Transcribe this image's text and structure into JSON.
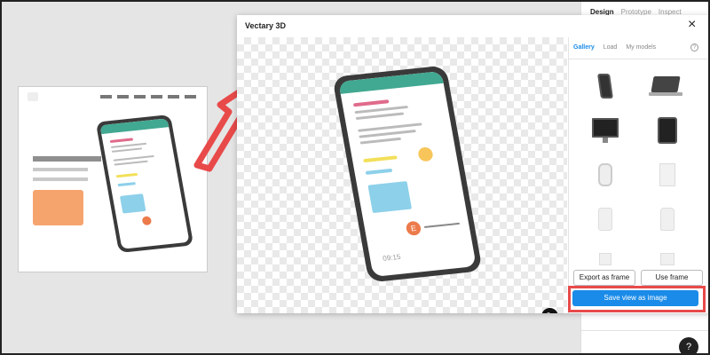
{
  "inspect": {
    "tabs": [
      "Design",
      "Prototype",
      "Inspect"
    ]
  },
  "modal": {
    "title": "Vectary 3D",
    "close_icon": "×",
    "tabs": [
      {
        "label": "Gallery",
        "active": true
      },
      {
        "label": "Load",
        "active": false
      },
      {
        "label": "My models",
        "active": false
      }
    ],
    "help_icon": "?",
    "gallery": [
      "phone-mockup",
      "laptop-mockup",
      "monitor-mockup",
      "tablet-mockup",
      "watch-mockup",
      "box-mockup",
      "can-mockup",
      "jar-mockup",
      "bottle-mockup",
      "bag-mockup"
    ],
    "export_label": "Export as frame",
    "use_label": "Use frame",
    "save_label": "Save view as image",
    "edit_icon": "✎"
  },
  "phone_screen": {
    "time": "09:15",
    "avatar_letter": "E"
  },
  "help_fab": "?",
  "colors": {
    "accent": "#1a8be8",
    "highlight": "#e84a4a",
    "phone_header": "#41a891",
    "orange_block": "#f6a46e"
  }
}
